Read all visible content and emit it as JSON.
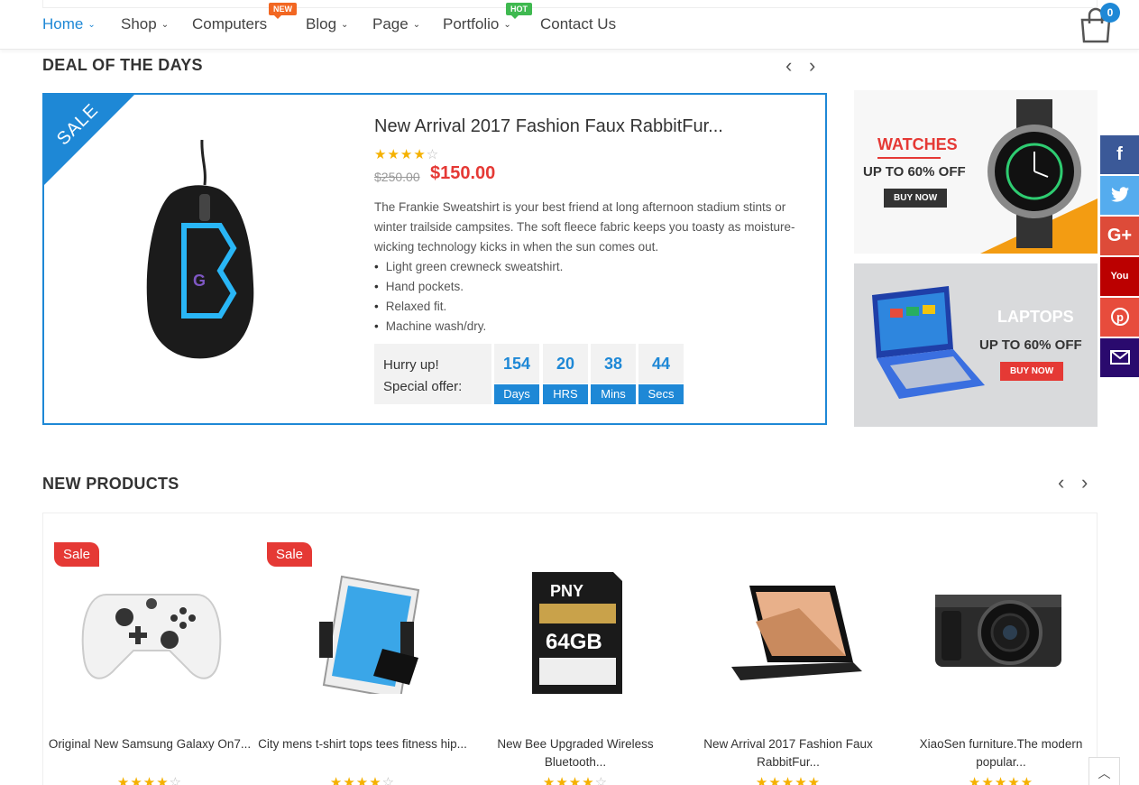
{
  "nav": {
    "items": [
      {
        "label": "Home",
        "chevron": "⌄"
      },
      {
        "label": "Shop",
        "chevron": "⌄"
      },
      {
        "label": "Computers",
        "badge": "NEW"
      },
      {
        "label": "Blog",
        "chevron": "⌄"
      },
      {
        "label": "Page",
        "chevron": "⌄"
      },
      {
        "label": "Portfolio",
        "chevron": "⌄",
        "badge": "HOT"
      },
      {
        "label": "Contact Us"
      }
    ],
    "cart_count": "0"
  },
  "deal": {
    "section_title": "DEAL OF THE DAYS",
    "ribbon": "SALE",
    "title": "New Arrival 2017 Fashion Faux RabbitFur...",
    "rating": "4 of 5",
    "old_price": "$250.00",
    "new_price": "$150.00",
    "description": "The Frankie Sweatshirt is your best friend at long afternoon stadium stints or winter trailside campsites. The soft fleece fabric keeps you toasty as moisture-wicking technology kicks in when the sun comes out.",
    "features": [
      "Light green crewneck sweatshirt.",
      "Hand pockets.",
      "Relaxed fit.",
      "Machine wash/dry."
    ],
    "hurry_line1": "Hurry up!",
    "hurry_line2": "Special offer:",
    "countdown": [
      {
        "value": "154",
        "label": "Days"
      },
      {
        "value": "20",
        "label": "HRS"
      },
      {
        "value": "38",
        "label": "Mins"
      },
      {
        "value": "44",
        "label": "Secs"
      }
    ]
  },
  "banners": [
    {
      "title": "WATCHES",
      "subtitle": "UP TO 60% OFF",
      "button": "BUY NOW"
    },
    {
      "title": "LAPTOPS",
      "subtitle": "UP TO 60% OFF",
      "button": "BUY NOW"
    }
  ],
  "social": [
    {
      "icon": "facebook-icon",
      "glyph": "f",
      "color": "#3b5998"
    },
    {
      "icon": "twitter-icon",
      "glyph": "🐦",
      "color": "#55acee"
    },
    {
      "icon": "google-plus-icon",
      "glyph": "G+",
      "color": "#dd4b39"
    },
    {
      "icon": "youtube-icon",
      "glyph": "You",
      "color": "#bb0000"
    },
    {
      "icon": "pinterest-icon",
      "glyph": "℗",
      "color": "#e74c3c"
    },
    {
      "icon": "email-icon",
      "glyph": "✉",
      "color": "#2a0a6e"
    }
  ],
  "new_products": {
    "section_title": "NEW PRODUCTS",
    "items": [
      {
        "name": "Original New Samsung Galaxy On7...",
        "sale": "Sale",
        "rating": "4 of 5"
      },
      {
        "name": "City mens t-shirt tops tees fitness hip...",
        "sale": "Sale",
        "rating": "4 of 5"
      },
      {
        "name": "New Bee Upgraded Wireless Bluetooth...",
        "sale": "",
        "rating": "4 of 5"
      },
      {
        "name": "New Arrival 2017 Fashion Faux RabbitFur...",
        "sale": "",
        "rating": "5 of 5"
      },
      {
        "name": "XiaoSen furniture.The modern popular...",
        "sale": "",
        "rating": "5 of 5"
      }
    ]
  },
  "colors": {
    "accent": "#1e88d6",
    "sale": "#e53935",
    "star": "#f5b100"
  }
}
